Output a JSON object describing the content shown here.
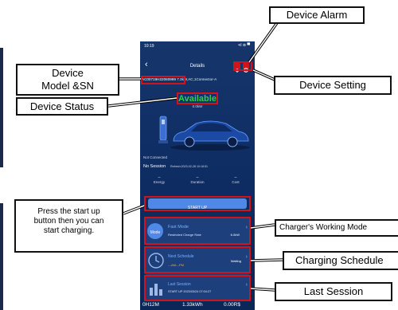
{
  "phone": {
    "time": "10:19",
    "status_icons": "•ıl ⊜ ▀",
    "header_title": "Details",
    "model_sn": "AC00719H22060999",
    "model_spec": "7.3kW,AC,1Connector-A",
    "status": "Available",
    "status_power": "0.0kW",
    "connection_state": "Not Connected",
    "session_state": "No Session",
    "refresh_text": "Refresh:2023-02-28 10:18:51",
    "stats": [
      {
        "value": "--",
        "label": "Energy"
      },
      {
        "value": "--",
        "label": "Duration"
      },
      {
        "value": "--",
        "label": "Cost"
      }
    ],
    "start_button": "START UP",
    "mode_badge": "Mode",
    "mode_title": "Fast Mode",
    "mode_sub": "Restricted Charge Rate",
    "mode_value": "6.0kW",
    "schedule_title": "Next Schedule",
    "schedule_times": "---AM---PM",
    "schedule_status": "Waiting",
    "last_title": "Last Session",
    "last_sub": "START UP 2023/03/24 07:04:27",
    "bottom_duration": "0H12M",
    "bottom_energy": "1.33kWh",
    "bottom_cost": "0.00R$"
  },
  "callouts": {
    "device_alarm": "Device Alarm",
    "device_model_line1": "Device",
    "device_model_line2": "Model &SN",
    "device_setting": "Device Setting",
    "device_status": "Device Status",
    "press_start": "Press the start up button then you can start charging.",
    "working_mode": "Charger's Working Mode",
    "charging_schedule": "Charging Schedule",
    "last_session": "Last Session"
  },
  "colors": {
    "accent_red": "#d0141c",
    "available_green": "#2fd04a",
    "start_button_blue": "#4f88e6",
    "screen_bg": "#0f2f66"
  },
  "icons": [
    "back-arrow-icon",
    "bell-icon",
    "gear-icon",
    "charging-station-icon",
    "car-icon",
    "clock-icon",
    "bar-chart-icon",
    "chevron-right-icon"
  ]
}
